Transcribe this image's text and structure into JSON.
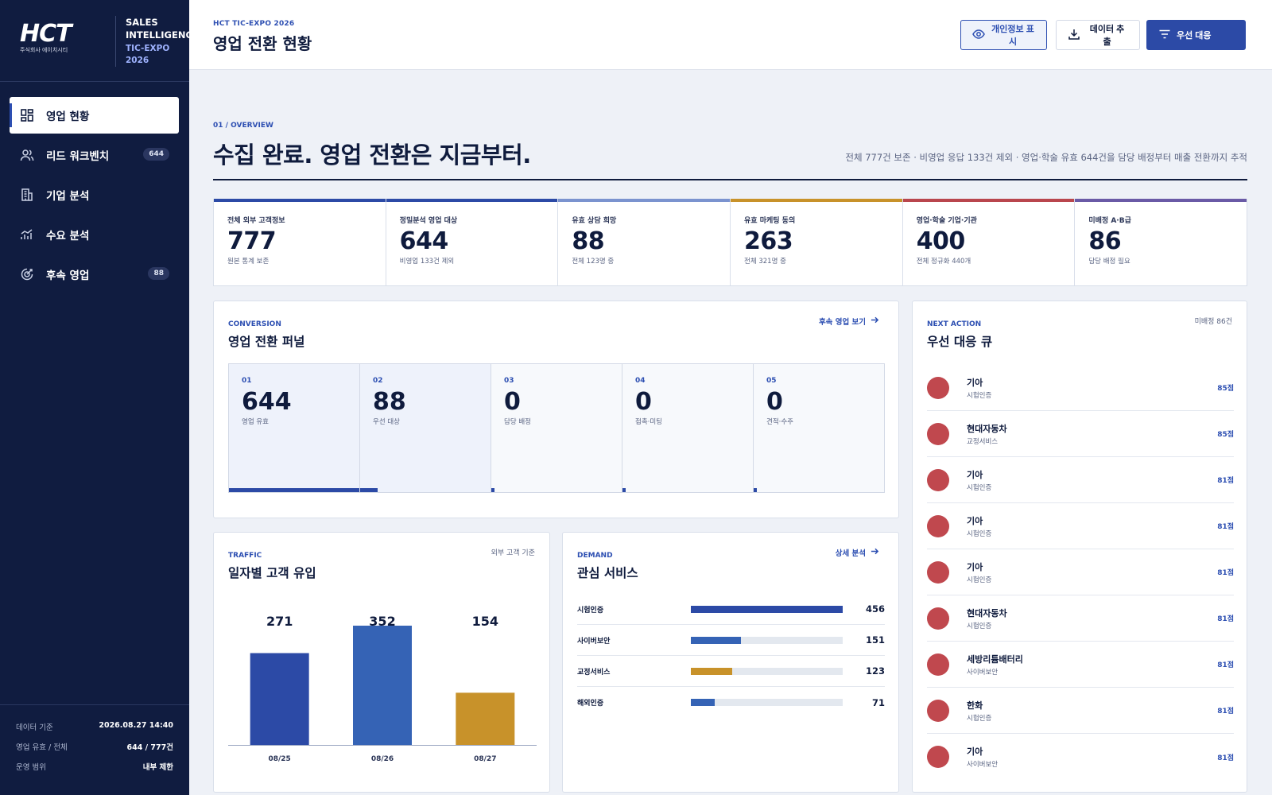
{
  "brand": {
    "logo_text": "HCT",
    "logo_sub": "주식회사 에이치시티",
    "line1": "SALES",
    "line2": "INTELLIGENCE",
    "line3": "TIC-EXPO",
    "line4": "2026"
  },
  "nav": [
    {
      "label": "영업 현황",
      "icon": "dashboard-icon",
      "active": true,
      "badge": ""
    },
    {
      "label": "리드 워크벤치",
      "icon": "users-icon",
      "active": false,
      "badge": "644"
    },
    {
      "label": "기업 분석",
      "icon": "building-icon",
      "active": false,
      "badge": ""
    },
    {
      "label": "수요 분석",
      "icon": "chart-icon",
      "active": false,
      "badge": ""
    },
    {
      "label": "후속 영업",
      "icon": "follow-up-icon",
      "active": false,
      "badge": "88"
    }
  ],
  "footer": {
    "data_label": "데이터 기준",
    "data_value": "2026.08.27 14:40",
    "ratio_label": "영업 유효 / 전체",
    "ratio_value": "644 / 777건",
    "scope_label": "운영 범위",
    "scope_value": "내부 제한"
  },
  "header": {
    "eyebrow": "HCT TIC-EXPO 2026",
    "title": "영업 전환 현황",
    "btn_privacy": "개인정보 표시",
    "btn_export": "데이터 추출",
    "btn_priority": "우선 대응"
  },
  "overview": {
    "eyebrow": "01 / OVERVIEW",
    "title": "수집 완료. 영업 전환은 지금부터.",
    "desc": "전체 777건 보존 · 비영업 응답 133건 제외 · 영업·학술 유효 644건을 담당 배정부터 매출 전환까지 추적"
  },
  "kpis": [
    {
      "label": "전체 외부 고객정보",
      "value": "777",
      "sub": "원본 통계 보존",
      "color": "#2c4aa6"
    },
    {
      "label": "정밀분석 영업 대상",
      "value": "644",
      "sub": "비영업 133건 제외",
      "color": "#2c4aa6"
    },
    {
      "label": "유효 상담 희망",
      "value": "88",
      "sub": "전체 123명 중",
      "color": "#7b93cf"
    },
    {
      "label": "유효 마케팅 동의",
      "value": "263",
      "sub": "전체 321명 중",
      "color": "#c8922a"
    },
    {
      "label": "영업·학술 기업·기관",
      "value": "400",
      "sub": "전체 정규화 440개",
      "color": "#b9464d"
    },
    {
      "label": "미배정 A·B급",
      "value": "86",
      "sub": "담당 배정 필요",
      "color": "#6a5aa6"
    }
  ],
  "funnel": {
    "eyebrow": "CONVERSION",
    "title": "영업 전환 퍼널",
    "link": "후속 영업 보기",
    "stages": [
      {
        "num": "01",
        "value": 644,
        "label": "영업 유효"
      },
      {
        "num": "02",
        "value": 88,
        "label": "우선 대상"
      },
      {
        "num": "03",
        "value": 0,
        "label": "담당 배정"
      },
      {
        "num": "04",
        "value": 0,
        "label": "접촉·미팅"
      },
      {
        "num": "05",
        "value": 0,
        "label": "견적·수주"
      }
    ]
  },
  "traffic": {
    "eyebrow": "TRAFFIC",
    "title": "일자별 고객 유입",
    "note": "외부 고객 기준"
  },
  "chart_data": {
    "type": "bar",
    "categories": [
      "08/25",
      "08/26",
      "08/27"
    ],
    "values": [
      271,
      352,
      154
    ],
    "colors": [
      "#2c4aa6",
      "#3563b5",
      "#c8922a"
    ],
    "title": "일자별 고객 유입",
    "xlabel": "",
    "ylabel": "",
    "ylim": [
      0,
      352
    ],
    "grid": false
  },
  "demand": {
    "eyebrow": "DEMAND",
    "title": "관심 서비스",
    "link": "상세 분석",
    "max": 456,
    "items": [
      {
        "name": "시험인증",
        "value": 456,
        "color": "#2c4aa6"
      },
      {
        "name": "사이버보안",
        "value": 151,
        "color": "#3563b5"
      },
      {
        "name": "교정서비스",
        "value": 123,
        "color": "#c8922a"
      },
      {
        "name": "해외인증",
        "value": 71,
        "color": "#3563b5"
      }
    ]
  },
  "queue": {
    "eyebrow": "NEXT ACTION",
    "title": "우선 대응 큐",
    "note": "미배정 86건",
    "items": [
      {
        "name": "기아",
        "cat": "시험인증",
        "score": "85점"
      },
      {
        "name": "현대자동차",
        "cat": "교정서비스",
        "score": "85점"
      },
      {
        "name": "기아",
        "cat": "시험인증",
        "score": "81점"
      },
      {
        "name": "기아",
        "cat": "시험인증",
        "score": "81점"
      },
      {
        "name": "기아",
        "cat": "시험인증",
        "score": "81점"
      },
      {
        "name": "현대자동차",
        "cat": "시험인증",
        "score": "81점"
      },
      {
        "name": "세방리튬배터리",
        "cat": "사이버보안",
        "score": "81점"
      },
      {
        "name": "한화",
        "cat": "시험인증",
        "score": "81점"
      },
      {
        "name": "기아",
        "cat": "사이버보안",
        "score": "81점"
      }
    ]
  }
}
